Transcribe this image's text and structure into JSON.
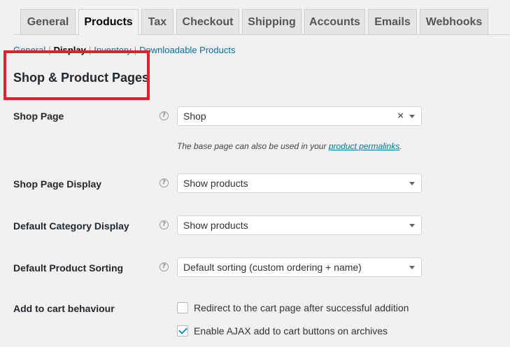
{
  "tabs": [
    {
      "label": "General",
      "active": false
    },
    {
      "label": "Products",
      "active": true
    },
    {
      "label": "Tax",
      "active": false
    },
    {
      "label": "Checkout",
      "active": false
    },
    {
      "label": "Shipping",
      "active": false
    },
    {
      "label": "Accounts",
      "active": false
    },
    {
      "label": "Emails",
      "active": false
    },
    {
      "label": "Webhooks",
      "active": false
    }
  ],
  "subnav": {
    "general": "General",
    "display": "Display",
    "inventory": "Inventory",
    "downloadable": "Downloadable Products",
    "separator": "|"
  },
  "section": {
    "title": "Shop & Product Pages"
  },
  "fields": {
    "help_glyph": "?",
    "shop_page": {
      "label": "Shop Page",
      "value": "Shop",
      "clear_glyph": "×",
      "description_prefix": "The base page can also be used in your ",
      "description_link": "product permalinks",
      "description_suffix": "."
    },
    "shop_page_display": {
      "label": "Shop Page Display",
      "value": "Show products"
    },
    "default_category_display": {
      "label": "Default Category Display",
      "value": "Show products"
    },
    "default_product_sorting": {
      "label": "Default Product Sorting",
      "value": "Default sorting (custom ordering + name)"
    },
    "add_to_cart": {
      "label": "Add to cart behaviour",
      "options": [
        {
          "label": "Redirect to the cart page after successful addition",
          "checked": false
        },
        {
          "label": "Enable AJAX add to cart buttons on archives",
          "checked": true
        }
      ]
    }
  },
  "colors": {
    "accent_link": "#0073aa",
    "highlight": "#e0202a",
    "checkmark": "#1e8cbe"
  }
}
